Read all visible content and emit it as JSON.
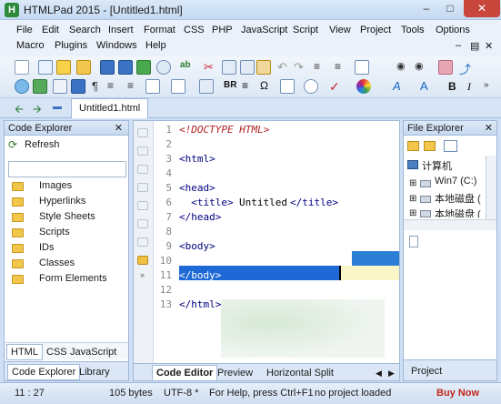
{
  "window": {
    "title": "HTMLPad 2015 - [Untitled1.html]",
    "app_icon": "H"
  },
  "menu": {
    "row1": [
      "File",
      "Edit",
      "Search",
      "Insert",
      "Format",
      "CSS",
      "PHP",
      "JavaScript",
      "Script",
      "View",
      "Project",
      "Tools",
      "Options"
    ],
    "row2": [
      "Macro",
      "Plugins",
      "Windows",
      "Help"
    ]
  },
  "toolbar": {
    "br_label": "BR",
    "bold_label": "B",
    "italic_label": "I",
    "pilcrow": "¶"
  },
  "document_tab": {
    "label": "Untitled1.html"
  },
  "code_explorer": {
    "title": "Code Explorer",
    "refresh_label": "Refresh",
    "items": [
      "Images",
      "Hyperlinks",
      "Style Sheets",
      "Scripts",
      "IDs",
      "Classes",
      "Form Elements"
    ],
    "lang_tabs": [
      "HTML",
      "CSS",
      "JavaScript"
    ],
    "panel_tabs": [
      "Code Explorer",
      "Library"
    ]
  },
  "editor": {
    "line_numbers": [
      "1",
      "2",
      "3",
      "4",
      "5",
      "6",
      "7",
      "8",
      "9",
      "10",
      "11",
      "12",
      "13"
    ],
    "lines": {
      "l1": "<!DOCTYPE HTML>",
      "l3": "<html>",
      "l5": "<head>",
      "l6a": "  <title>",
      "l6b": "Untitled",
      "l6c": "</title>",
      "l7": "</head>",
      "l9": "<body>",
      "l11": "</body>",
      "l13": "</html>"
    },
    "view_tabs": [
      "Code Editor",
      "Preview",
      "Horizontal Split"
    ]
  },
  "file_explorer": {
    "title": "File Explorer",
    "items": [
      "计算机",
      "Win7 (C:)",
      "本地磁盘 (",
      "本地磁盘 ("
    ],
    "project_label": "Project"
  },
  "status": {
    "position": "11 : 27",
    "size": "105 bytes",
    "encoding": "UTF-8 *",
    "help": "For Help, press Ctrl+F1",
    "project": "no project loaded",
    "buy": "Buy Now"
  },
  "colors": {
    "selection": "#1e69d6",
    "tag": "#000080",
    "doctype": "#b02020",
    "buy": "#c0271a"
  }
}
